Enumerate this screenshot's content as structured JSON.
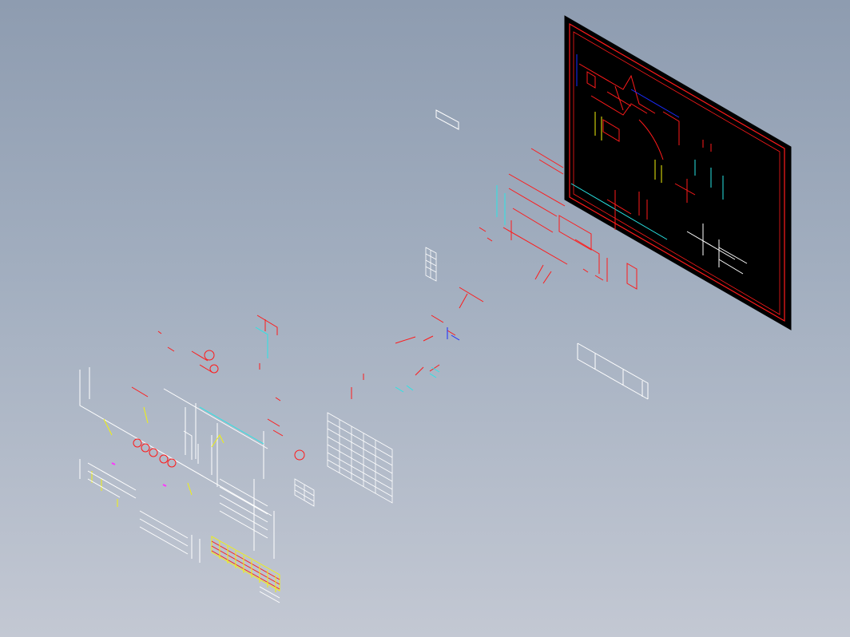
{
  "scene": {
    "background_top": "#8e9cb0",
    "background_bottom": "#c3c8d3",
    "view": "isometric",
    "objects": [
      "drawing-sheet-black",
      "small-frame-1",
      "table-grid-small",
      "table-grid-large",
      "table-grid-tiny",
      "frame-lines-right",
      "scattered-cad-entities",
      "title-block-area"
    ]
  },
  "palette": {
    "red": "#ff1a1a",
    "cyan": "#29e6e6",
    "white": "#ffffff",
    "yellow": "#f2f20d",
    "blue": "#1a2cff",
    "magenta": "#ff33ff",
    "black_sheet": "#000000"
  }
}
